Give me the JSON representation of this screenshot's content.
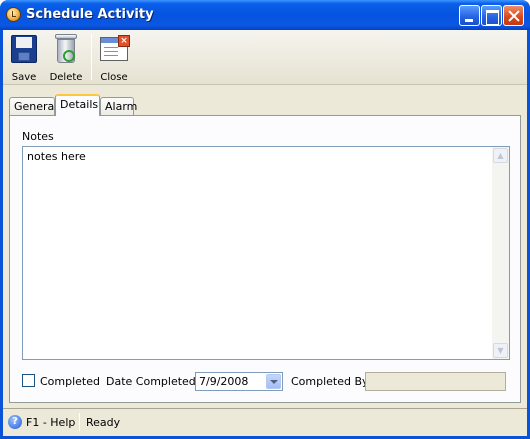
{
  "window": {
    "title": "Schedule Activity",
    "controls": [
      "minimize",
      "maximize",
      "close"
    ]
  },
  "toolbar": {
    "save_label": "Save",
    "delete_label": "Delete",
    "close_label": "Close"
  },
  "tabs": [
    {
      "label": "General",
      "active": false
    },
    {
      "label": "Details",
      "active": true
    },
    {
      "label": "Alarm",
      "active": false
    }
  ],
  "details": {
    "notes_label": "Notes",
    "notes_value": "notes here",
    "completed_label": "Completed",
    "completed_checked": false,
    "date_completed_label": "Date Completed",
    "date_completed_value": "7/9/2008",
    "completed_by_label": "Completed By",
    "completed_by_value": ""
  },
  "statusbar": {
    "help_text": "F1 - Help",
    "status_text": "Ready"
  },
  "colors": {
    "titlebar": "#0553df",
    "tab_accent": "#ffc83c",
    "face": "#ece9d8"
  }
}
